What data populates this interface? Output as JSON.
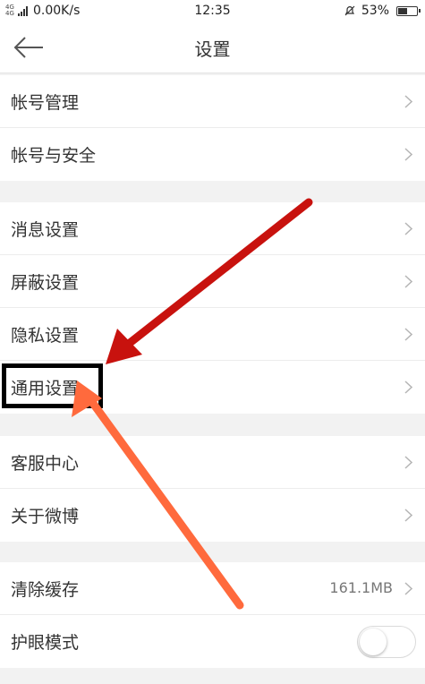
{
  "status_bar": {
    "network_type": "4G 4G",
    "speed": "0.00K/s",
    "time": "12:35",
    "battery": "53%",
    "battery_level": 0.53
  },
  "nav": {
    "title": "设置",
    "back_icon": "arrow-left-icon"
  },
  "groups": [
    {
      "items": [
        {
          "label": "帐号管理"
        },
        {
          "label": "帐号与安全"
        }
      ]
    },
    {
      "items": [
        {
          "label": "消息设置"
        },
        {
          "label": "屏蔽设置"
        },
        {
          "label": "隐私设置"
        },
        {
          "label": "通用设置"
        }
      ]
    },
    {
      "items": [
        {
          "label": "客服中心"
        },
        {
          "label": "关于微博"
        }
      ]
    },
    {
      "items": [
        {
          "label": "清除缓存",
          "value": "161.1MB"
        },
        {
          "label": "护眼模式",
          "toggle": false
        }
      ]
    }
  ],
  "annotations": {
    "highlighted_item": "通用设置",
    "arrow_colors": [
      "#c8120e",
      "#ff6a3d"
    ],
    "box_color": "#000000"
  }
}
